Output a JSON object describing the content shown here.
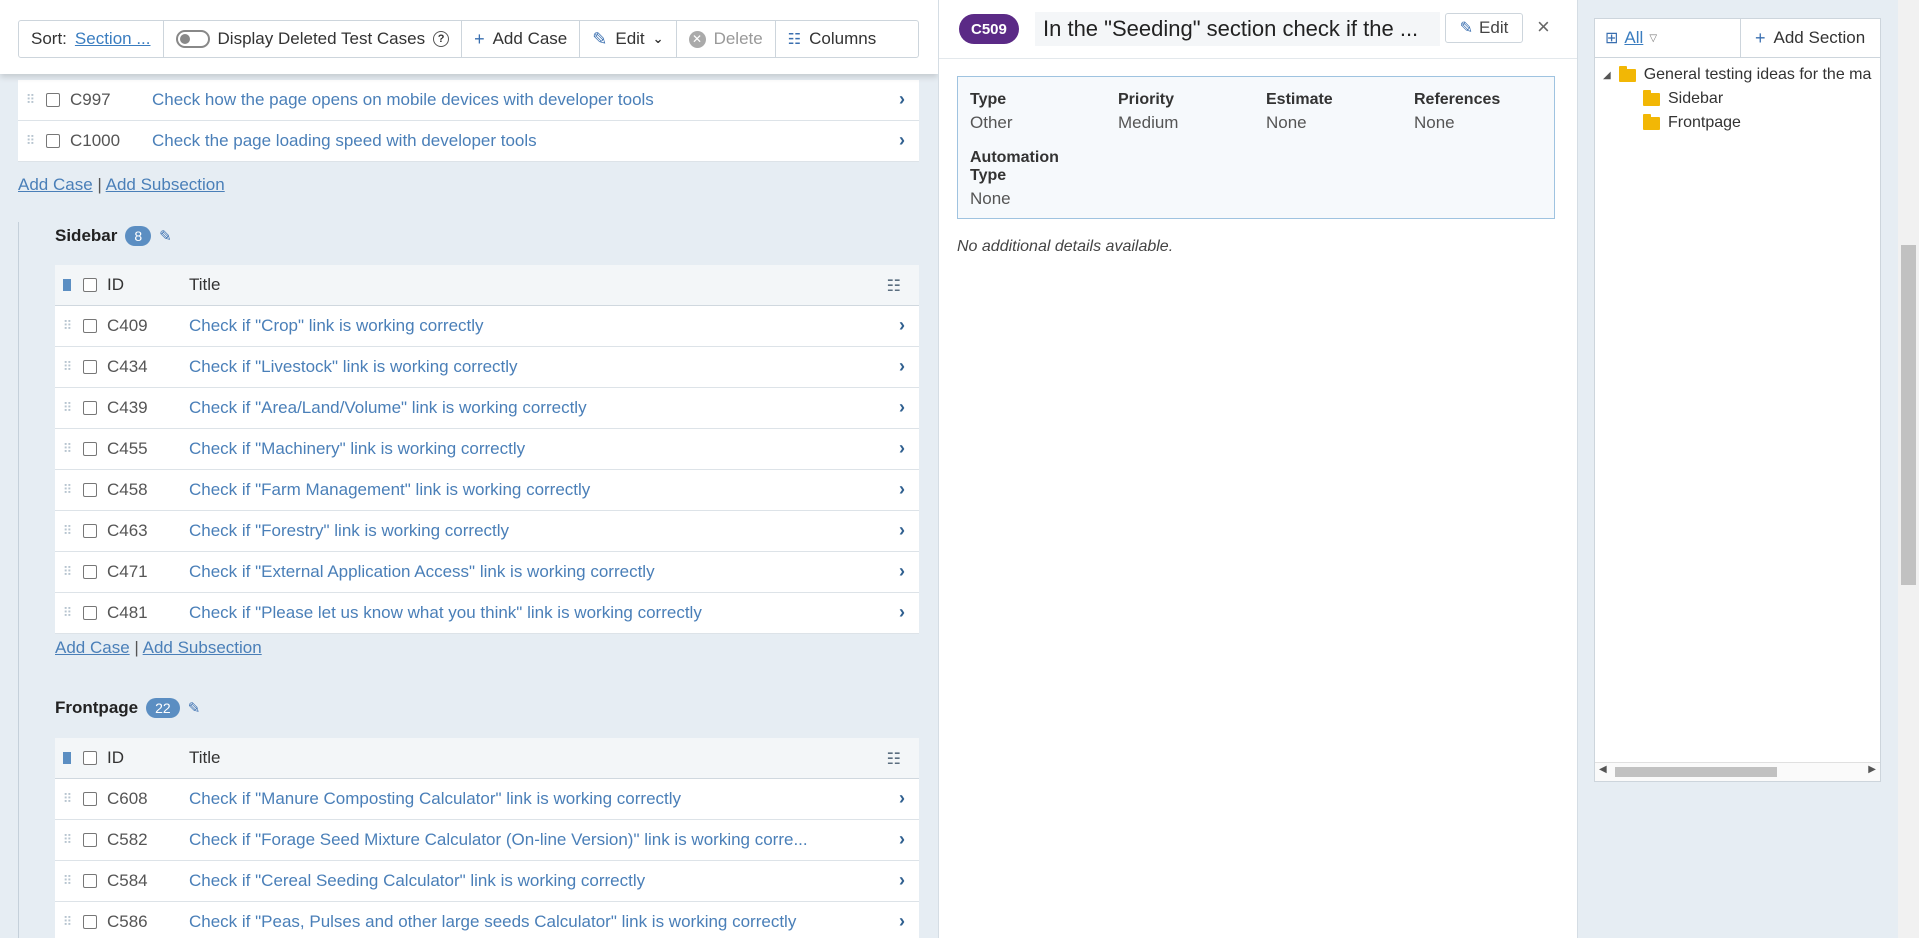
{
  "toolbar": {
    "sort_label": "Sort:",
    "sort_value": "Section ...",
    "display_deleted": "Display Deleted Test Cases",
    "help": "?",
    "add_case": "Add Case",
    "edit": "Edit",
    "delete": "Delete",
    "columns": "Columns"
  },
  "top_rows": [
    {
      "id": "C997",
      "title": "Check how the page opens on mobile devices with developer tools"
    },
    {
      "id": "C1000",
      "title": "Check the page loading speed with developer tools"
    }
  ],
  "links": {
    "add_case": "Add Case",
    "sep": "|",
    "add_subsection": "Add Subsection"
  },
  "columns": {
    "id": "ID",
    "title": "Title"
  },
  "sidebar_section": {
    "name": "Sidebar",
    "count": "8",
    "rows": [
      {
        "id": "C409",
        "title": "Check if \"Crop\" link is working correctly"
      },
      {
        "id": "C434",
        "title": "Check if \"Livestock\" link is working correctly"
      },
      {
        "id": "C439",
        "title": "Check if \"Area/Land/Volume\" link is working correctly"
      },
      {
        "id": "C455",
        "title": "Check if \"Machinery\" link is working correctly"
      },
      {
        "id": "C458",
        "title": "Check if \"Farm Management\" link is working correctly"
      },
      {
        "id": "C463",
        "title": "Check if \"Forestry\" link is working correctly"
      },
      {
        "id": "C471",
        "title": "Check if \"External Application Access\" link is working correctly"
      },
      {
        "id": "C481",
        "title": "Check if \"Please let us know what you think\" link is working correctly"
      }
    ]
  },
  "frontpage_section": {
    "name": "Frontpage",
    "count": "22",
    "rows": [
      {
        "id": "C608",
        "title": "Check if \"Manure Composting Calculator\" link is working correctly"
      },
      {
        "id": "C582",
        "title": "Check if \"Forage Seed Mixture Calculator (On-line Version)\" link is working corre..."
      },
      {
        "id": "C584",
        "title": "Check if \"Cereal Seeding Calculator\" link is working correctly"
      },
      {
        "id": "C586",
        "title": "Check if \"Peas, Pulses and other large seeds Calculator\" link is working correctly"
      }
    ]
  },
  "detail": {
    "case_id": "C509",
    "title": "In the \"Seeding\" section check if the ...",
    "edit": "Edit",
    "close": "×",
    "props": {
      "type_label": "Type",
      "type_value": "Other",
      "priority_label": "Priority",
      "priority_value": "Medium",
      "estimate_label": "Estimate",
      "estimate_value": "None",
      "references_label": "References",
      "references_value": "None",
      "automation_label_1": "Automation",
      "automation_label_2": "Type",
      "automation_value": "None"
    },
    "no_details": "No additional details available."
  },
  "tree": {
    "filter": "All",
    "add_section": "Add Section",
    "root": "General testing ideas for the ma",
    "children": [
      "Sidebar",
      "Frontpage"
    ]
  }
}
